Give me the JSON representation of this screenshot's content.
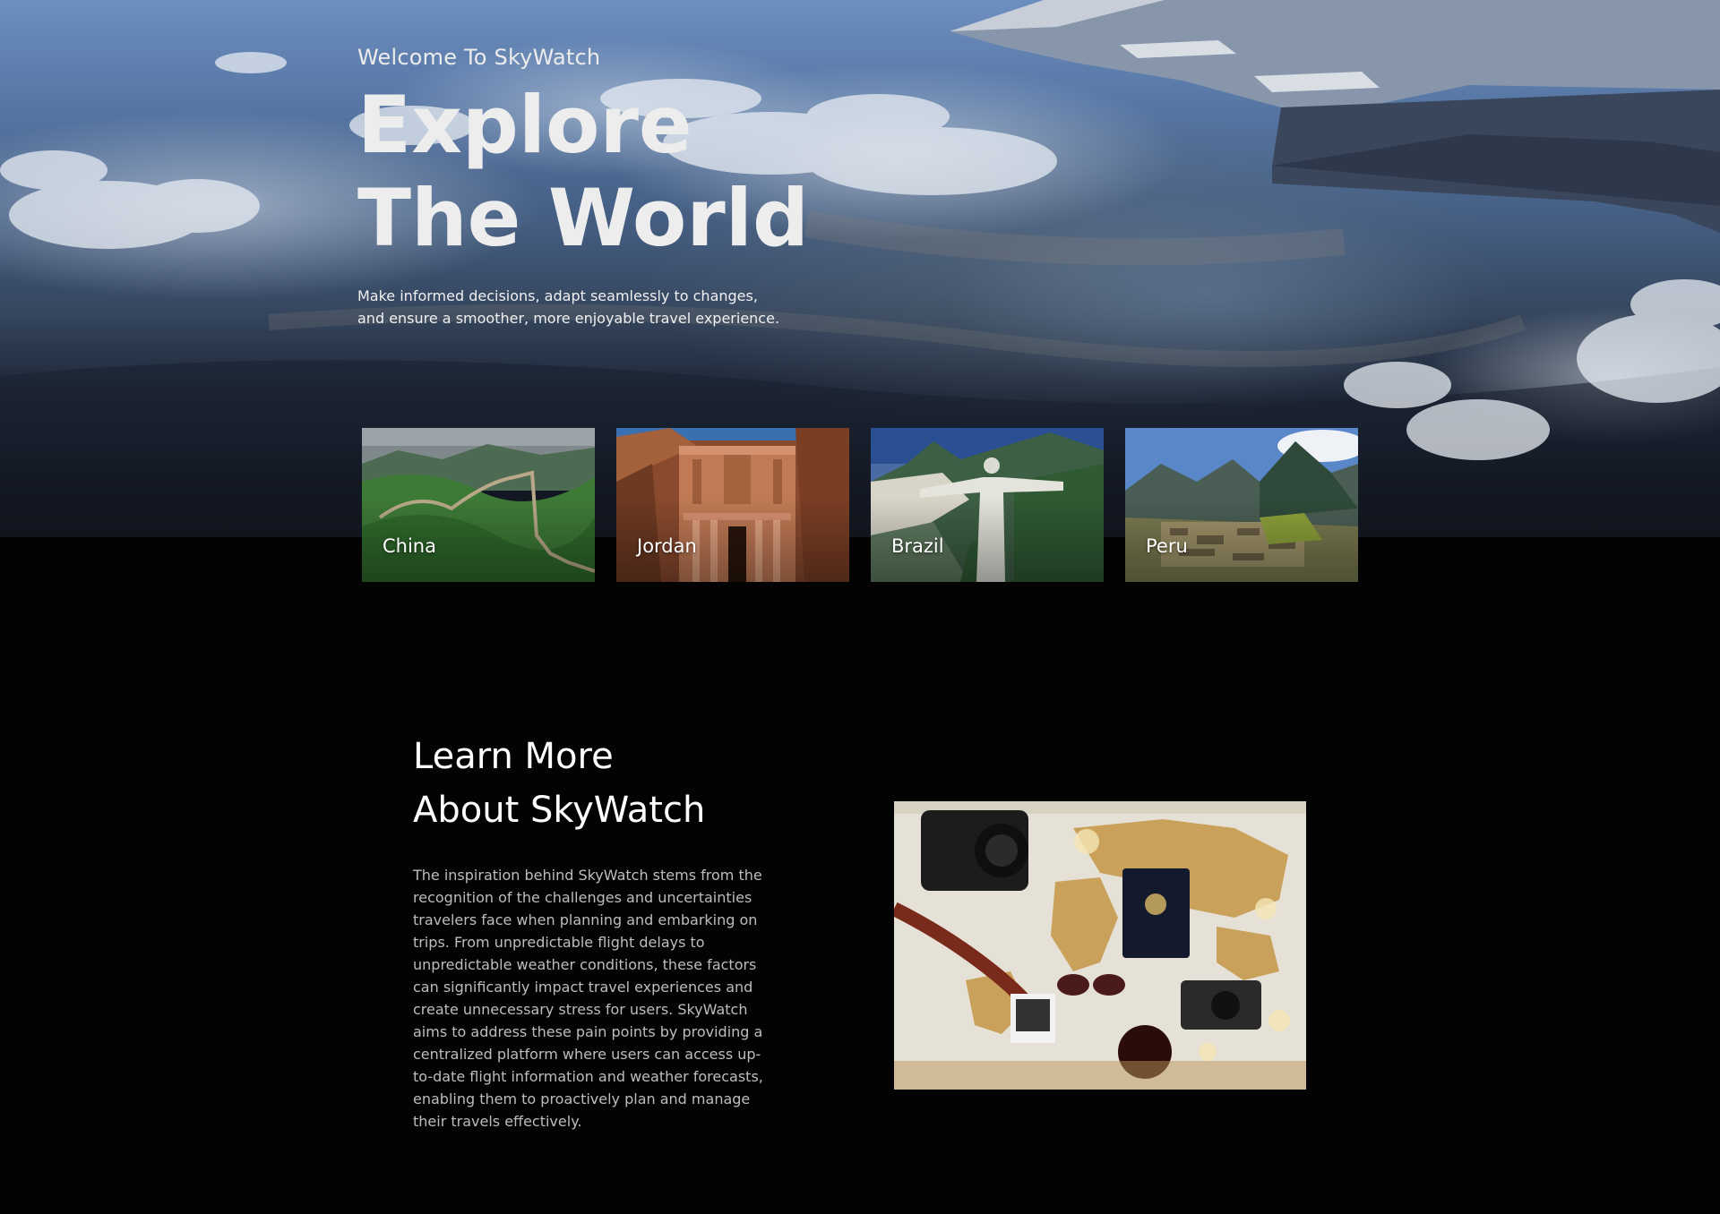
{
  "hero": {
    "welcome": "Welcome To SkyWatch",
    "title_line1": "Explore",
    "title_line2": "The World",
    "description": "Make informed decisions, adapt seamlessly to changes, and ensure a smoother, more enjoyable travel experience."
  },
  "destinations": [
    {
      "label": "China"
    },
    {
      "label": "Jordan"
    },
    {
      "label": "Brazil"
    },
    {
      "label": "Peru"
    }
  ],
  "about": {
    "title_line1": "Learn More",
    "title_line2": "About SkyWatch",
    "body": "The inspiration behind SkyWatch stems from the recognition of the challenges and uncertainties travelers face when planning and embarking on trips. From unpredictable flight delays to unpredictable weather conditions, these factors can significantly impact travel experiences and create unnecessary stress for users. SkyWatch aims to address these pain points by providing a centralized platform where users can access up-to-date flight information and weather forecasts, enabling them to proactively plan and manage their travels effectively."
  },
  "colors": {
    "background": "#030303",
    "text_primary": "#ffffff",
    "text_muted": "#bdbdbd"
  }
}
